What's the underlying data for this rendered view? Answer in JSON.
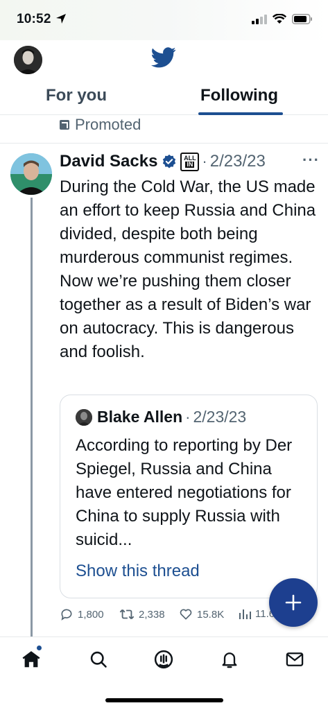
{
  "status_bar": {
    "time": "10:52"
  },
  "header": {
    "tabs": [
      {
        "label": "For you",
        "active": false
      },
      {
        "label": "Following",
        "active": true
      }
    ]
  },
  "promoted": {
    "label": "Promoted"
  },
  "tweet": {
    "author_name": "David Sacks",
    "badge_text": {
      "top": "ALL",
      "bottom": "IN"
    },
    "date": "2/23/23",
    "more_label": "···",
    "text": "During the Cold War, the US made an effort to keep Russia and China divided, despite both being murderous communist regimes. Now we’re pushing them closer together as a result of Biden’s war on autocracy. This is dangerous and foolish.",
    "quote": {
      "author_name": "Blake Allen",
      "date": "2/23/23",
      "text": "According to reporting by Der Spiegel, Russia and China have entered negotiations for China to supply Russia with suicid...",
      "link_label": "Show this thread"
    },
    "stats": {
      "replies": "1,800",
      "retweets": "2,338",
      "likes": "15.8K",
      "views": "11.6"
    }
  },
  "fab": {
    "icon": "plus-icon"
  },
  "bottom_nav": {
    "items": [
      {
        "icon": "home-icon"
      },
      {
        "icon": "search-icon"
      },
      {
        "icon": "spaces-icon"
      },
      {
        "icon": "notifications-icon"
      },
      {
        "icon": "messages-icon"
      }
    ]
  },
  "colors": {
    "accent": "#1d4f91",
    "verified": "#1d4f91",
    "text_secondary": "#536471",
    "fab": "#1d3f8f"
  }
}
